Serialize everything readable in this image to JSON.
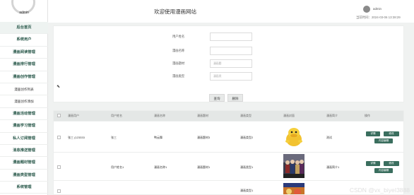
{
  "sidebar": {
    "admin_label": "admin",
    "items": [
      {
        "label": "后台首页"
      },
      {
        "label": "系统用户"
      },
      {
        "label": "漫画阅读管理"
      },
      {
        "label": "漫画排行管理"
      },
      {
        "label": "漫画创作管理"
      },
      {
        "label": "漫画创作列表"
      },
      {
        "label": "漫画创作添加"
      },
      {
        "label": "漫画活动管理"
      },
      {
        "label": "漫画学习管理"
      },
      {
        "label": "私人订阅管理"
      },
      {
        "label": "消息推送管理"
      },
      {
        "label": "漫画题材管理"
      },
      {
        "label": "漫画类型管理"
      },
      {
        "label": "系统管理"
      }
    ]
  },
  "header": {
    "title": "欢迎使用漫画网站",
    "user": "admin",
    "time_label": "当前时间：",
    "time_value": "2024-03-06 13:38:29"
  },
  "search": {
    "fields": [
      {
        "label": "用户姓名",
        "placeholder": ""
      },
      {
        "label": "漫画名称",
        "placeholder": ""
      },
      {
        "label": "漫画题材",
        "placeholder": "漫画题"
      },
      {
        "label": "漫画类型",
        "placeholder": "漫画类"
      }
    ],
    "search_label": "查询",
    "delete_label": "删除"
  },
  "table": {
    "headers": [
      "漫画用户",
      "用户姓名",
      "漫画名称",
      "漫画题材",
      "漫画类型",
      "漫画封面",
      "漫画简介",
      "操作"
    ],
    "rows": [
      {
        "user": "张三 (123333",
        "name": "张三",
        "title": "鸭云舞",
        "theme": "漫画题材3",
        "type": "漫画类型2",
        "intro": "测试"
      },
      {
        "user": "",
        "name": "用户姓名1",
        "title": "漫画名称1",
        "theme": "漫画题材1",
        "type": "漫画类型1",
        "intro": "漫画简介1"
      },
      {
        "user": "",
        "name": "",
        "title": "",
        "theme": "",
        "type": "漫画类型1",
        "intro": ""
      }
    ],
    "actions": {
      "detail": "详情",
      "edit": "修改",
      "delete": "删除",
      "content": "内容编辑"
    }
  },
  "watermark": "CSDN @vx_biyeI3888"
}
